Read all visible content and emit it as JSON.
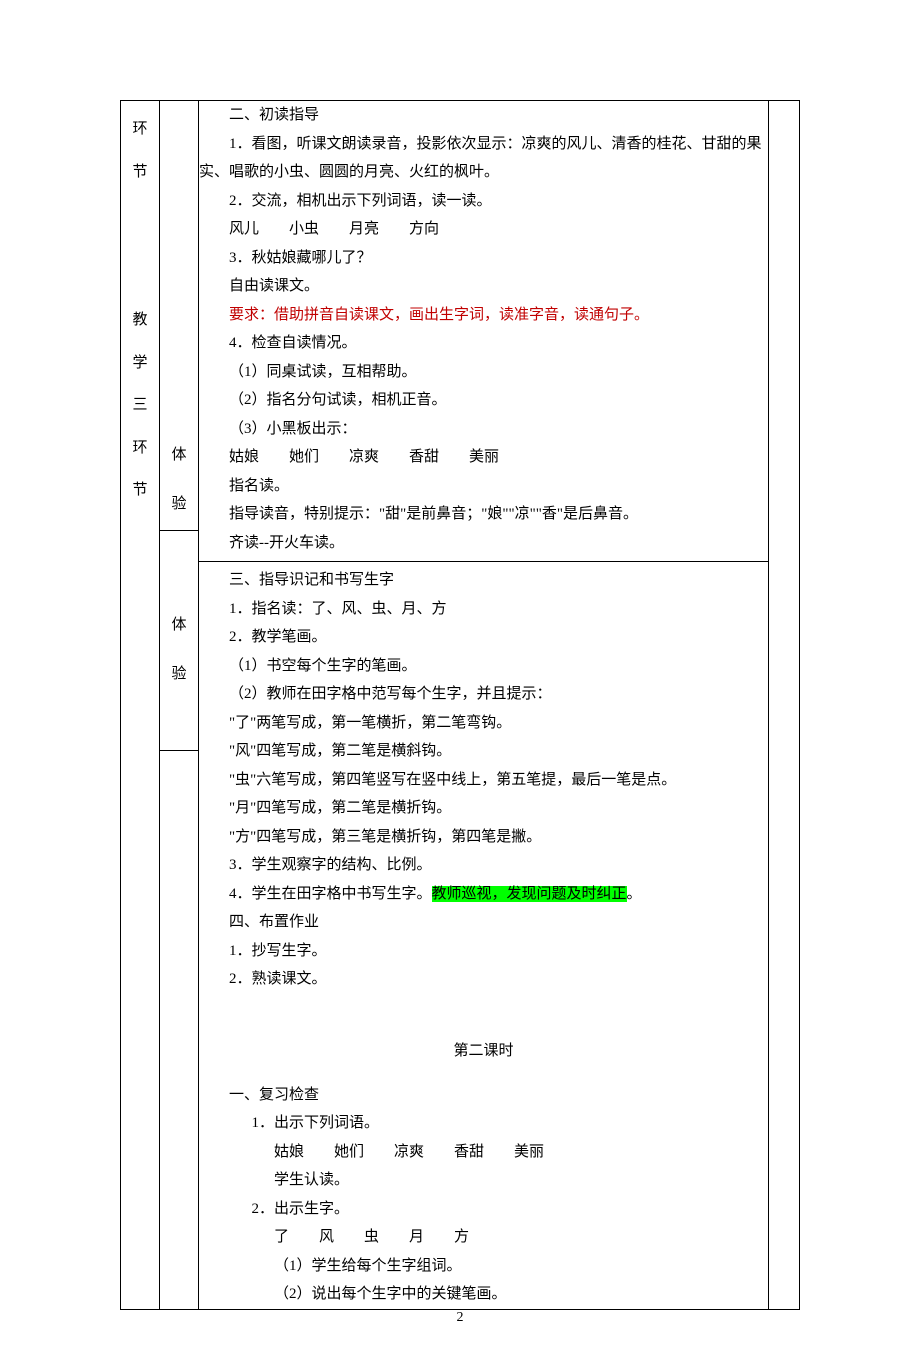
{
  "col1": [
    "环",
    "节",
    "教",
    "学",
    "三",
    "环",
    "节"
  ],
  "col2_rows": [
    {
      "chars": [
        "体",
        "验"
      ]
    },
    {
      "chars": [
        "体",
        "验"
      ]
    },
    {
      "chars": []
    }
  ],
  "content": {
    "s2_title": "二、初读指导",
    "s2_p1": "1．看图，听课文朗读录音，投影依次显示：凉爽的风儿、清香的桂花、甘甜的果实、唱歌的小虫、圆圆的月亮、火红的枫叶。",
    "s2_p2": "2．交流，相机出示下列词语，读一读。",
    "s2_p2a": "风儿　　小虫　　月亮　　方向",
    "s2_p3": "3．秋姑娘藏哪儿了？",
    "s2_p3a": "自由读课文。",
    "s2_p3b_red": "要求：借助拼音自读课文，画出生字词，读准字音，读通句子。",
    "s2_p4": "4．检查自读情况。",
    "s2_p4a": "（1）同桌试读，互相帮助。",
    "s2_p4b": "（2）指名分句试读，相机正音。",
    "s2_p4c": "（3）小黑板出示：",
    "s2_p4c1": "姑娘　　她们　　凉爽　　香甜　　美丽",
    "s2_p4c2": "指名读。",
    "s2_p4c3": "指导读音，特别提示：\"甜\"是前鼻音；\"娘\"\"凉\"\"香\"是后鼻音。",
    "s2_p4c4": "齐读--开火车读。",
    "s3_title": "三、指导识记和书写生字",
    "s3_p1": "1．指名读：了、风、虫、月、方",
    "s3_p2": "2．教学笔画。",
    "s3_p2a": "（1）书空每个生字的笔画。",
    "s3_p2b": "（2）教师在田字格中范写每个生字，并且提示：",
    "s3_p2c": "\"了\"两笔写成，第一笔横折，第二笔弯钩。",
    "s3_p2d": "\"风\"四笔写成，第二笔是横斜钩。",
    "s3_p2e": "\"虫\"六笔写成，第四笔竖写在竖中线上，第五笔提，最后一笔是点。",
    "s3_p2f": "\"月\"四笔写成，第二笔是横折钩。",
    "s3_p2g": "\"方\"四笔写成，第三笔是横折钩，第四笔是撇。",
    "s3_p3": "3．学生观察字的结构、比例。",
    "s3_p4a": "4．学生在田字格中书写生字。",
    "s3_p4b_hl": "教师巡视，发现问题及时纠正",
    "s3_p4c": "。",
    "s4_title": "四、布置作业",
    "s4_p1": "1．抄写生字。",
    "s4_p2": "2．熟读课文。",
    "lesson2_title": "第二课时",
    "l2_s1_title": "一、复习检查",
    "l2_s1_p1": "1．出示下列词语。",
    "l2_s1_p1a": "姑娘　　她们　　凉爽　　香甜　　美丽",
    "l2_s1_p1b": "学生认读。",
    "l2_s1_p2": "2．出示生字。",
    "l2_s1_p2a": "了　　风　　虫　　月　　方",
    "l2_s1_p2b": "（1）学生给每个生字组词。",
    "l2_s1_p2c": "（2）说出每个生字中的关键笔画。"
  },
  "page_number": "2"
}
